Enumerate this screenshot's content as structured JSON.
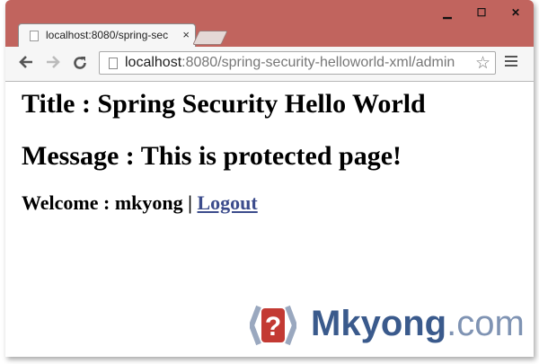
{
  "window": {
    "controls": [
      "minimize-icon",
      "maximize-icon",
      "close-icon"
    ],
    "frame_color": "#c1645e"
  },
  "tab": {
    "title": "localhost:8080/spring-sec",
    "close": "×"
  },
  "toolbar": {
    "url_host": "localhost",
    "url_rest": ":8080/spring-security-helloworld-xml/admin"
  },
  "page": {
    "title": "Title : Spring Security Hello World",
    "message": "Message : This is protected page!",
    "welcome_prefix": "Welcome : mkyong | ",
    "logout": "Logout"
  },
  "watermark": {
    "brand": "Mkyong",
    "suffix": ".com",
    "icon_glyph": "?",
    "brand_color": "#3a5a8c"
  }
}
